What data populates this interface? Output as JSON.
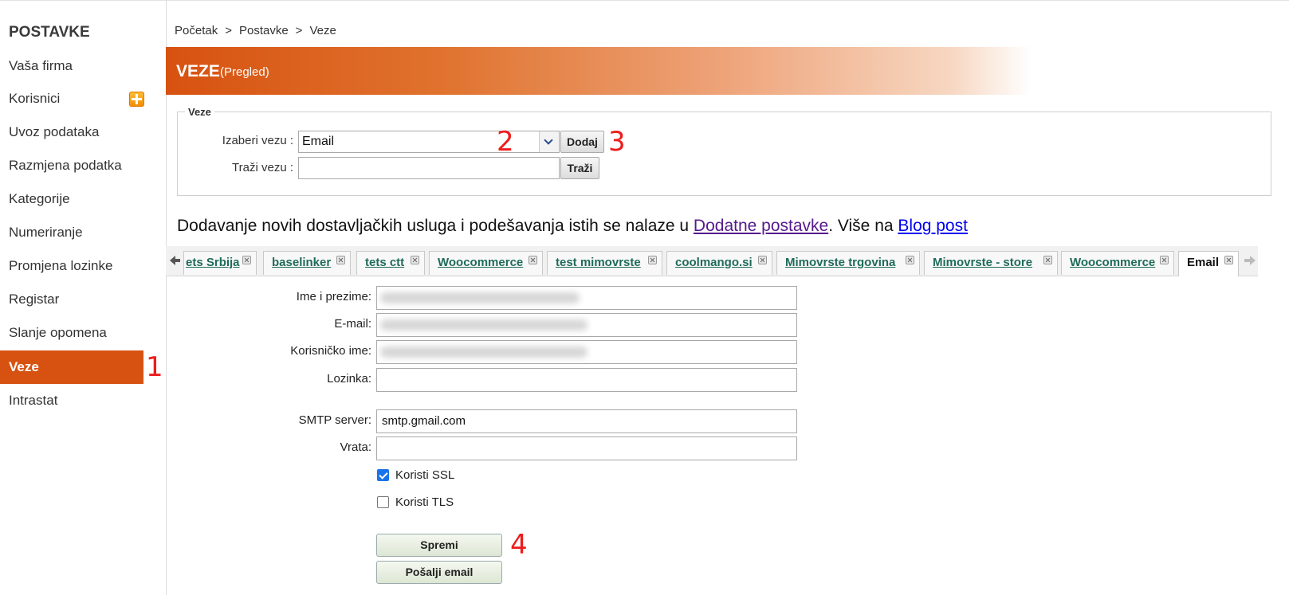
{
  "sidebar": {
    "title": "POSTAVKE",
    "items": [
      {
        "label": "Vaša firma"
      },
      {
        "label": "Korisnici"
      },
      {
        "label": "Uvoz podataka"
      },
      {
        "label": "Razmjena podatka"
      },
      {
        "label": "Kategorije"
      },
      {
        "label": "Numeriranje"
      },
      {
        "label": "Promjena lozinke"
      },
      {
        "label": "Registar"
      },
      {
        "label": "Slanje opomena"
      },
      {
        "label": "Veze"
      },
      {
        "label": "Intrastat"
      }
    ]
  },
  "breadcrumb": {
    "items": [
      "Početak",
      "Postavke",
      "Veze"
    ],
    "separator": ">"
  },
  "header": {
    "title": "VEZE",
    "subtitle": "(Pregled)"
  },
  "connections": {
    "legend": "Veze",
    "select_label": "Izaberi vezu :",
    "select_value": "Email",
    "add_button": "Dodaj",
    "search_label": "Traži vezu :",
    "search_value": "",
    "search_button": "Traži"
  },
  "info": {
    "text1": "Dodavanje novih dostavljačkih usluga i podešavanja istih se nalaze u ",
    "link1": "Dodatne postavke",
    "text2": ". Više na ",
    "link2": "Blog post"
  },
  "tabs": [
    {
      "label": "ets Srbija"
    },
    {
      "label": "baselinker"
    },
    {
      "label": "tets ctt"
    },
    {
      "label": "Woocommerce"
    },
    {
      "label": "test mimovrste"
    },
    {
      "label": "coolmango.si"
    },
    {
      "label": "Mimovrste trgovina"
    },
    {
      "label": "Mimovrste - store"
    },
    {
      "label": "Woocommerce"
    },
    {
      "label": "Email"
    }
  ],
  "form": {
    "name_label": "Ime i prezime:",
    "email_label": "E-mail:",
    "username_label": "Korisničko ime:",
    "password_label": "Lozinka:",
    "smtp_label": "SMTP server:",
    "smtp_value": "smtp.gmail.com",
    "port_label": "Vrata:",
    "ssl_label": "Koristi SSL",
    "ssl_checked": true,
    "tls_label": "Koristi TLS",
    "tls_checked": false,
    "save_button": "Spremi",
    "send_button": "Pošalji email"
  },
  "annotations": [
    "1",
    "2",
    "3",
    "4"
  ],
  "colors": {
    "accent": "#d75210",
    "tab_text": "#1f6b5a",
    "annotation": "#ee1c1c"
  }
}
